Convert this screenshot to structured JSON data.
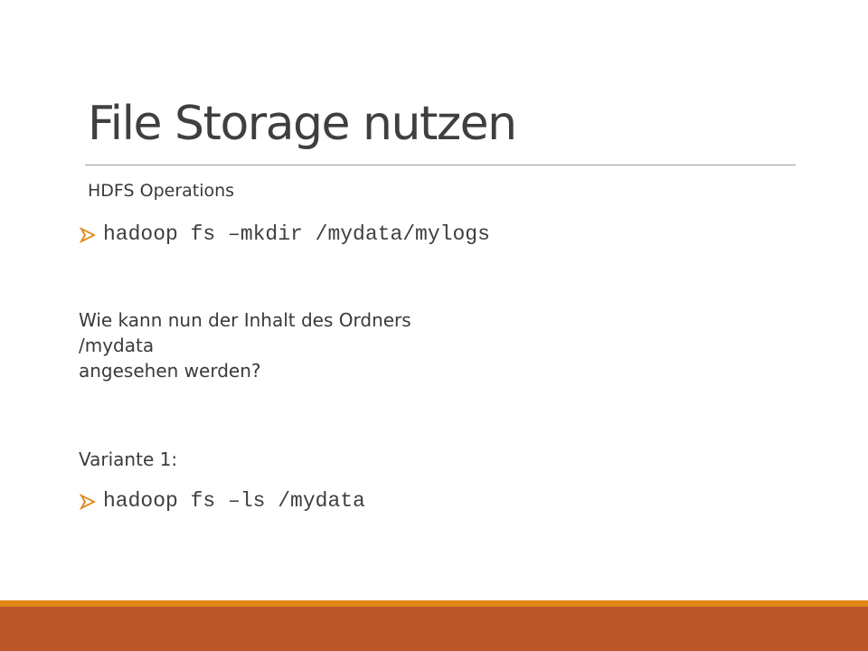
{
  "slide": {
    "title": "File Storage nutzen",
    "subtitle": "HDFS Operations",
    "commands": [
      "hadoop fs –mkdir /mydata/mylogs",
      "hadoop fs –ls /mydata"
    ],
    "question_lines": [
      "Wie kann nun der Inhalt des Ordners",
      "/mydata",
      "angesehen werden?"
    ],
    "variant_label": "Variante 1:",
    "bullet_icon": "arrow-bullet-icon"
  },
  "colors": {
    "accent_orange": "#df8617",
    "accent_rust": "#bb552a",
    "text": "#3f3f3f",
    "rule": "#9a9a9a"
  }
}
